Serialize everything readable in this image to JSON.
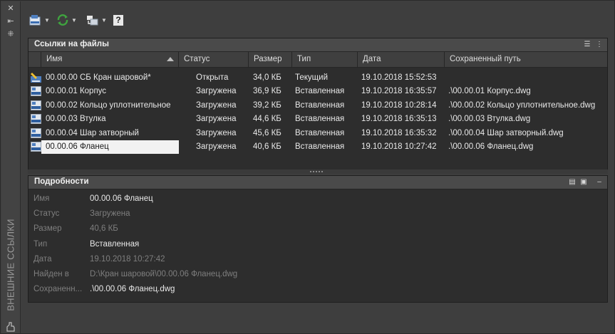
{
  "palette_title": "ВНЕШНИЕ ССЫЛКИ",
  "colors": {
    "accent_green": "#3fa33f",
    "selected_bg": "#f2f2f2"
  },
  "toolbar": {
    "buttons": [
      {
        "name": "attach-dwg-button",
        "icon": "dwg-attach-icon"
      },
      {
        "name": "refresh-button",
        "icon": "refresh-icon"
      },
      {
        "name": "change-path-button",
        "icon": "path-icon"
      },
      {
        "name": "help-button",
        "icon": "help-icon",
        "label": "?"
      }
    ]
  },
  "file_refs": {
    "title": "Ссылки на файлы",
    "columns": [
      "Имя",
      "Статус",
      "Размер",
      "Тип",
      "Дата",
      "Сохраненный путь"
    ],
    "rows": [
      {
        "name": "00.00.00 СБ Кран шаровой*",
        "status": "Открыта",
        "size": "34,0 КБ",
        "type": "Текущий",
        "date": "19.10.2018 15:52:53",
        "path": "",
        "icon": "current-drawing-icon"
      },
      {
        "name": "00.00.01 Корпус",
        "status": "Загружена",
        "size": "36,9 КБ",
        "type": "Вставленная",
        "date": "19.10.2018 16:35:57",
        "path": ".\\00.00.01 Корпус.dwg",
        "icon": "dwg-file-icon"
      },
      {
        "name": "00.00.02 Кольцо уплотнительное",
        "status": "Загружена",
        "size": "39,2 КБ",
        "type": "Вставленная",
        "date": "19.10.2018 10:28:14",
        "path": ".\\00.00.02 Кольцо уплотнительное.dwg",
        "icon": "dwg-file-icon"
      },
      {
        "name": "00.00.03 Втулка",
        "status": "Загружена",
        "size": "44,6 КБ",
        "type": "Вставленная",
        "date": "19.10.2018 16:35:13",
        "path": ".\\00.00.03 Втулка.dwg",
        "icon": "dwg-file-icon"
      },
      {
        "name": "00.00.04 Шар затворный",
        "status": "Загружена",
        "size": "45,6 КБ",
        "type": "Вставленная",
        "date": "19.10.2018 16:35:32",
        "path": ".\\00.00.04 Шар затворный.dwg",
        "icon": "dwg-file-icon"
      },
      {
        "name": "00.00.06 Фланец",
        "status": "Загружена",
        "size": "40,6 КБ",
        "type": "Вставленная",
        "date": "19.10.2018 10:27:42",
        "path": ".\\00.00.06 Фланец.dwg",
        "icon": "dwg-file-icon",
        "selected": true
      }
    ]
  },
  "details": {
    "title": "Подробности",
    "fields": [
      {
        "label": "Имя",
        "value": "00.00.06 Фланец",
        "editable": true
      },
      {
        "label": "Статус",
        "value": "Загружена",
        "editable": false
      },
      {
        "label": "Размер",
        "value": "40,6 КБ",
        "editable": false
      },
      {
        "label": "Тип",
        "value": "Вставленная",
        "editable": true
      },
      {
        "label": "Дата",
        "value": "19.10.2018 10:27:42",
        "editable": false
      },
      {
        "label": "Найден в",
        "value": "D:\\Кран шаровой\\00.00.06 Фланец.dwg",
        "editable": false
      },
      {
        "label": "Сохраненн...",
        "value": ".\\00.00.06 Фланец.dwg",
        "editable": true
      }
    ]
  }
}
